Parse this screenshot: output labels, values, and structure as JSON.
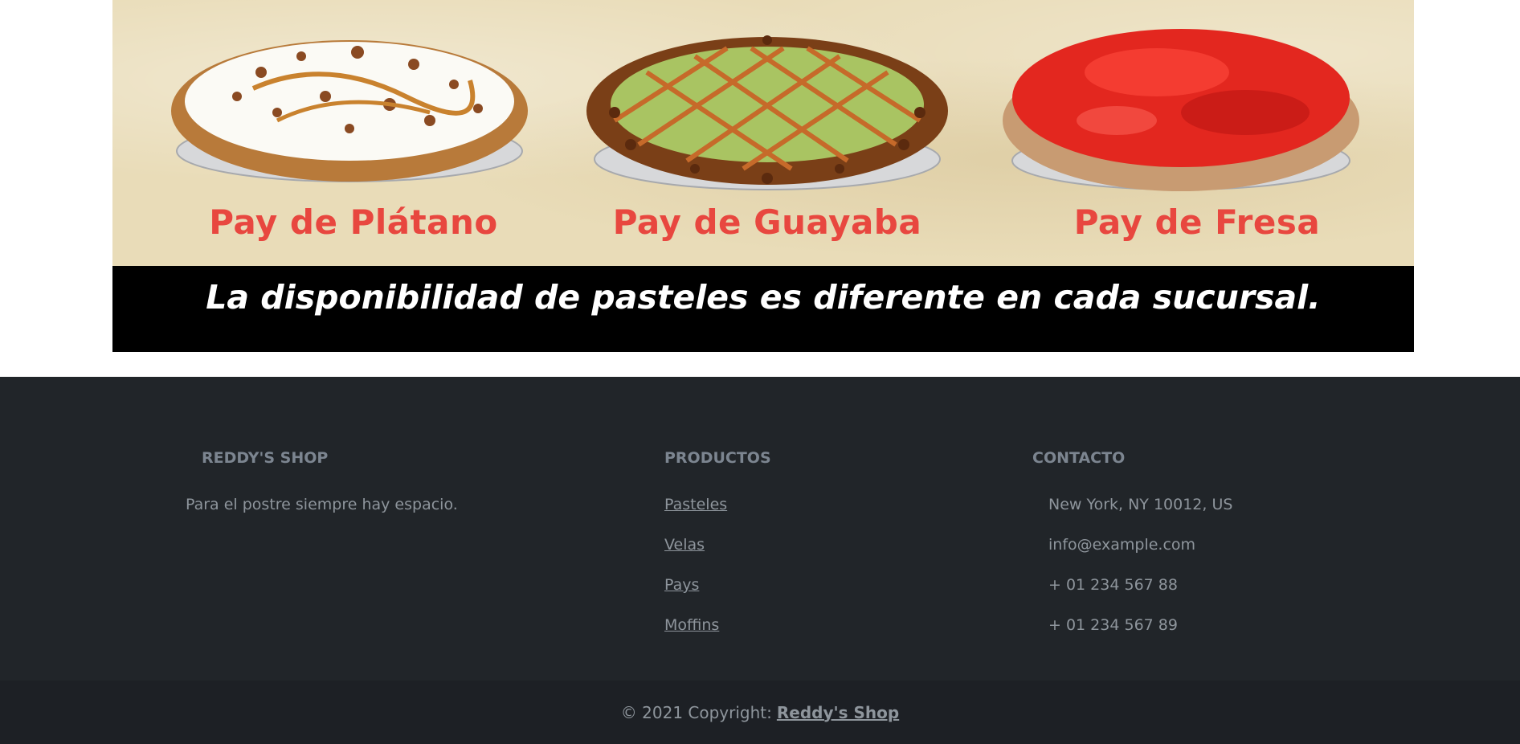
{
  "banner": {
    "pies": [
      {
        "label": "Pay de Plátano",
        "filling_color": "#fbfaf5",
        "topping_color": "#8a4a22",
        "glaze_color": "#c9822e"
      },
      {
        "label": "Pay de Guayaba",
        "filling_color": "#a9c462",
        "topping_color": "#7a3f17",
        "glaze_color": "#c66a2a"
      },
      {
        "label": "Pay de Fresa",
        "filling_color": "#e3271f",
        "topping_color": "#b4120f",
        "glaze_color": "#ff4b3e"
      }
    ],
    "availability_text": "La disponibilidad de pasteles es diferente en cada sucursal.",
    "label_color": "#e8473f",
    "background_color": "#e9dcb8"
  },
  "footer": {
    "about": {
      "title": "Reddy's Shop",
      "tagline": "Para el postre siempre hay espacio."
    },
    "products": {
      "title": "Productos",
      "links": [
        "Pasteles",
        "Velas",
        "Pays",
        "Moffins"
      ]
    },
    "contact": {
      "title": "Contacto",
      "address": "New York, NY 10012, US",
      "email": "info@example.com",
      "phone_1": "+ 01 234 567 88",
      "phone_2": "+ 01 234 567 89"
    },
    "copyright": {
      "prefix": "© 2021 Copyright:",
      "link_label": "Reddy's Shop"
    },
    "background_color": "#212529"
  }
}
